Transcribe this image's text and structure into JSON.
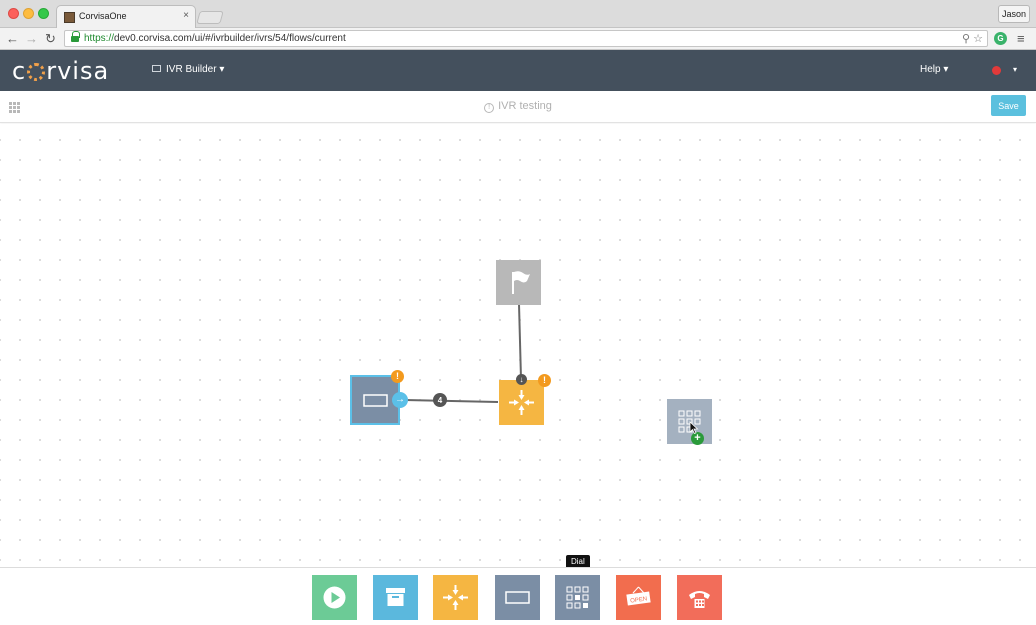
{
  "browser": {
    "tab_title": "CorvisaOne",
    "tab_close": "×",
    "user": "Jason",
    "url_scheme": "https://",
    "url_rest": "dev0.corvisa.com/ui/#/ivrbuilder/ivrs/54/flows/current",
    "nav_back": "←",
    "nav_forward": "→",
    "nav_reload": "↻",
    "url_icons": "⚲ ☆",
    "menu": "≡"
  },
  "app": {
    "logo_pre": "c",
    "logo_post": "rvisa",
    "module_label": "IVR Builder",
    "caret": "▾",
    "help_label": "Help",
    "status_color": "#e23a3a"
  },
  "flow": {
    "title": "IVR testing",
    "info_glyph": "!",
    "save_label": "Save"
  },
  "canvas": {
    "edge_label": "4",
    "warn_glyph": "!",
    "nodes": [
      {
        "name": "start-flag-node",
        "icon": "flag-icon",
        "color": "#b8b8b8"
      },
      {
        "name": "prompt-node",
        "icon": "rectangle-icon",
        "color": "#7b8ea5",
        "selected": true,
        "warning": true
      },
      {
        "name": "menu-node",
        "icon": "arrows-in-icon",
        "color": "#f5b642",
        "warning": true
      },
      {
        "name": "dial-node-dragging",
        "icon": "grid-icon",
        "color": "#a4b1c0",
        "adding": true
      }
    ]
  },
  "toolbar": {
    "tooltip": "Dial",
    "tools": [
      {
        "name": "play-tool",
        "icon": "play-icon",
        "color": "#6ccb96"
      },
      {
        "name": "archive-tool",
        "icon": "archive-icon",
        "color": "#5bb8dd"
      },
      {
        "name": "menu-tool",
        "icon": "arrows-in-icon",
        "color": "#f5b642"
      },
      {
        "name": "prompt-tool",
        "icon": "rectangle-icon",
        "color": "#7b8ea5"
      },
      {
        "name": "dial-tool",
        "icon": "grid-icon",
        "color": "#7b8ea5"
      },
      {
        "name": "hours-tool",
        "icon": "open-sign-icon",
        "color": "#f26d4e",
        "label": "OPEN"
      },
      {
        "name": "hangup-tool",
        "icon": "phone-icon",
        "color": "#f26d5a"
      }
    ]
  }
}
